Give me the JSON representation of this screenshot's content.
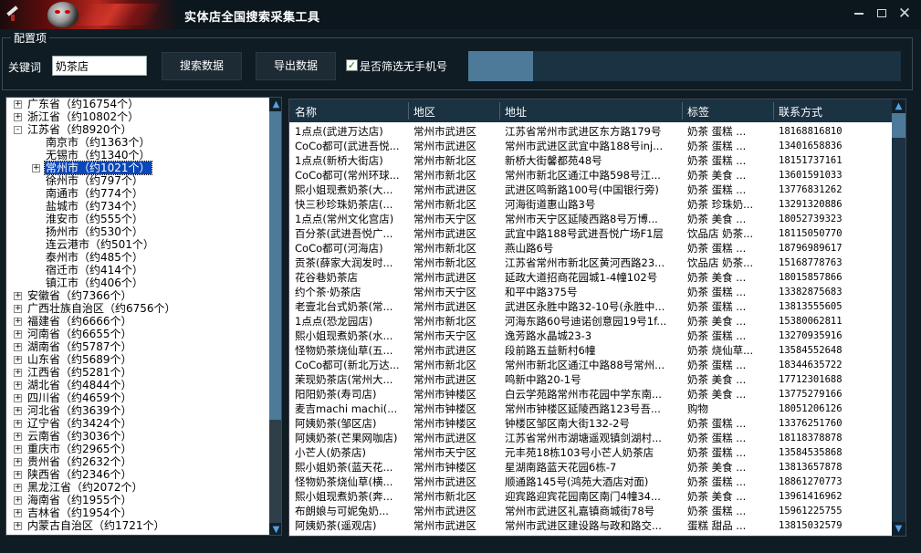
{
  "window": {
    "title": "实体店全国搜索采集工具",
    "controls": {
      "minimize": "—",
      "maximize": "□",
      "close": "✕"
    },
    "accent": "#4e7a9a",
    "background": "#0f1c24"
  },
  "config": {
    "legend": "配置项",
    "keyword_label": "关键词",
    "keyword_value": "奶茶店",
    "search_button": "搜索数据",
    "export_button": "导出数据",
    "filter_checked": true,
    "filter_check_glyph": "✓",
    "filter_label": "是否筛选无手机号",
    "progress": 0.15
  },
  "tree": {
    "nodes": [
      {
        "label": "广东省（约16754个）",
        "level": 0,
        "exp": "+"
      },
      {
        "label": "浙江省（约10802个）",
        "level": 0,
        "exp": "+"
      },
      {
        "label": "江苏省（约8920个）",
        "level": 0,
        "exp": "-"
      },
      {
        "label": "南京市（约1363个）",
        "level": 1,
        "exp": ""
      },
      {
        "label": "无锡市（约1340个）",
        "level": 1,
        "exp": ""
      },
      {
        "label": "常州市（约1021个）",
        "level": 1,
        "exp": "+",
        "selected": true
      },
      {
        "label": "徐州市（约797个）",
        "level": 1,
        "exp": ""
      },
      {
        "label": "南通市（约774个）",
        "level": 1,
        "exp": ""
      },
      {
        "label": "盐城市（约734个）",
        "level": 1,
        "exp": ""
      },
      {
        "label": "淮安市（约555个）",
        "level": 1,
        "exp": ""
      },
      {
        "label": "扬州市（约530个）",
        "level": 1,
        "exp": ""
      },
      {
        "label": "连云港市（约501个）",
        "level": 1,
        "exp": ""
      },
      {
        "label": "泰州市（约485个）",
        "level": 1,
        "exp": ""
      },
      {
        "label": "宿迁市（约414个）",
        "level": 1,
        "exp": ""
      },
      {
        "label": "镇江市（约406个）",
        "level": 1,
        "exp": ""
      },
      {
        "label": "安徽省（约7366个）",
        "level": 0,
        "exp": "+"
      },
      {
        "label": "广西壮族自治区（约6756个）",
        "level": 0,
        "exp": "+"
      },
      {
        "label": "福建省（约6666个）",
        "level": 0,
        "exp": "+"
      },
      {
        "label": "河南省（约6655个）",
        "level": 0,
        "exp": "+"
      },
      {
        "label": "湖南省（约5787个）",
        "level": 0,
        "exp": "+"
      },
      {
        "label": "山东省（约5689个）",
        "level": 0,
        "exp": "+"
      },
      {
        "label": "江西省（约5281个）",
        "level": 0,
        "exp": "+"
      },
      {
        "label": "湖北省（约4844个）",
        "level": 0,
        "exp": "+"
      },
      {
        "label": "四川省（约4659个）",
        "level": 0,
        "exp": "+"
      },
      {
        "label": "河北省（约3639个）",
        "level": 0,
        "exp": "+"
      },
      {
        "label": "辽宁省（约3424个）",
        "level": 0,
        "exp": "+"
      },
      {
        "label": "云南省（约3036个）",
        "level": 0,
        "exp": "+"
      },
      {
        "label": "重庆市（约2965个）",
        "level": 0,
        "exp": "+"
      },
      {
        "label": "贵州省（约2632个）",
        "level": 0,
        "exp": "+"
      },
      {
        "label": "陕西省（约2346个）",
        "level": 0,
        "exp": "+"
      },
      {
        "label": "黑龙江省（约2072个）",
        "level": 0,
        "exp": "+"
      },
      {
        "label": "海南省（约1955个）",
        "level": 0,
        "exp": "+"
      },
      {
        "label": "吉林省（约1954个）",
        "level": 0,
        "exp": "+"
      },
      {
        "label": "内蒙古自治区（约1721个）",
        "level": 0,
        "exp": "+"
      }
    ],
    "scroll_up": "▲",
    "scroll_down": "▼",
    "scroll_position": 0.0,
    "scroll_visible_fraction": 0.75
  },
  "table": {
    "columns": [
      "名称",
      "地区",
      "地址",
      "标签",
      "联系方式"
    ],
    "scroll_up": "▲",
    "scroll_down": "▼",
    "scroll_position": 0.0,
    "scroll_visible_fraction": 0.06,
    "rows": [
      [
        "1点点(武进万达店)",
        "常州市武进区",
        "江苏省常州市武进区东方路179号",
        "奶茶 蛋糕 ...",
        "18168816810"
      ],
      [
        "CoCo都可(武进吾悦...",
        "常州市武进区",
        "常州市武进区武宜中路188号inj...",
        "奶茶 蛋糕 ...",
        "13401658836"
      ],
      [
        "1点点(新桥大街店)",
        "常州市新北区",
        "新桥大街馨都苑48号",
        "奶茶 蛋糕 ...",
        "18151737161"
      ],
      [
        "CoCo都可(常州环球...",
        "常州市新北区",
        "常州市新北区通江中路598号江...",
        "奶茶 美食 ...",
        "13601591033"
      ],
      [
        "熙小姐现煮奶茶(大...",
        "常州市武进区",
        "武进区鸣新路100号(中国银行旁)",
        "奶茶 蛋糕 ...",
        "13776831262"
      ],
      [
        "快三秒珍珠奶茶店(...",
        "常州市新北区",
        "河海街道惠山路3号",
        "奶茶 珍珠奶...",
        "13291320886"
      ],
      [
        "1点点(常州文化宫店)",
        "常州市天宁区",
        "常州市天宁区延陵西路8号万博...",
        "奶茶 美食 ...",
        "18052739323"
      ],
      [
        "百分茶(武进吾悦广...",
        "常州市武进区",
        "武宜中路188号武进吾悦广场F1层",
        "饮品店 奶茶...",
        "18115050770"
      ],
      [
        "CoCo都可(河海店)",
        "常州市新北区",
        "燕山路6号",
        "奶茶 蛋糕 ...",
        "18796989617"
      ],
      [
        "贡茶(薛家大润发时...",
        "常州市新北区",
        "江苏省常州市新北区黄河西路23...",
        "饮品店 奶茶...",
        "15168778763"
      ],
      [
        "花谷巷奶茶店",
        "常州市武进区",
        "延政大道招商花园城1-4幢102号",
        "奶茶 美食 ...",
        "18015857866"
      ],
      [
        "约个茶·奶茶店",
        "常州市天宁区",
        "和平中路375号",
        "奶茶 蛋糕 ...",
        "13382875683"
      ],
      [
        "老壹北台式奶茶(常...",
        "常州市武进区",
        "武进区永胜中路32-10号(永胜中...",
        "奶茶 蛋糕 ...",
        "13813555605"
      ],
      [
        "1点点(恐龙园店)",
        "常州市新北区",
        "河海东路60号迪诺创意园19号1f...",
        "奶茶 美食 ...",
        "15380062811"
      ],
      [
        "熙小姐现煮奶茶(水...",
        "常州市天宁区",
        "逸芳路水晶城23-3",
        "奶茶 蛋糕 ...",
        "13270935916"
      ],
      [
        "怪物奶茶烧仙草(五...",
        "常州市武进区",
        "段前路五益新村6幢",
        "奶茶 烧仙草...",
        "13584552648"
      ],
      [
        "CoCo都可(新北万达...",
        "常州市新北区",
        "常州市新北区通江中路88号常州...",
        "奶茶 蛋糕 ...",
        "18344635722"
      ],
      [
        "茉现奶茶店(常州大...",
        "常州市武进区",
        "鸣新中路20-1号",
        "奶茶 美食 ...",
        "17712301688"
      ],
      [
        "阳阳奶茶(寿司店)",
        "常州市钟楼区",
        "白云学苑路常州市花园中学东南...",
        "奶茶 美食 ...",
        "13775279166"
      ],
      [
        "麦吉machi machi(...",
        "常州市钟楼区",
        "常州市钟楼区延陵西路123号吾...",
        "购物",
        "18051206126"
      ],
      [
        "阿姨奶茶(邹区店)",
        "常州市钟楼区",
        "钟楼区邹区南大街132-2号",
        "奶茶 蛋糕 ...",
        "13376251760"
      ],
      [
        "阿姨奶茶(芒果网咖店)",
        "常州市武进区",
        "江苏省常州市湖塘遥观镇剑湖村...",
        "奶茶 蛋糕 ...",
        "18118378878"
      ],
      [
        "小芒人(奶茶店)",
        "常州市天宁区",
        "元丰苑18栋103号小芒人奶茶店",
        "奶茶 蛋糕 ...",
        "13584535868"
      ],
      [
        "熙小姐奶茶(蓝天花...",
        "常州市钟楼区",
        "星湖南路蓝天花园6栋-7",
        "奶茶 美食 ...",
        "13813657878"
      ],
      [
        "怪物奶茶烧仙草(横...",
        "常州市武进区",
        "顺通路145号(鸿苑大酒店对面)",
        "奶茶 蛋糕 ...",
        "18861270773"
      ],
      [
        "熙小姐现煮奶茶(奔...",
        "常州市新北区",
        "迎宾路迎宾花园南区南门4幢34...",
        "奶茶 美食 ...",
        "13961416962"
      ],
      [
        "布朗娘与可妮兔奶...",
        "常州市武进区",
        "常州市武进区礼嘉镇商城街78号",
        "奶茶 蛋糕 ...",
        "15961225755"
      ],
      [
        "阿姨奶茶(遥观店)",
        "常州市武进区",
        "常州市武进区建设路与政和路交...",
        "蛋糕 甜品 ...",
        "13815032579"
      ]
    ]
  }
}
